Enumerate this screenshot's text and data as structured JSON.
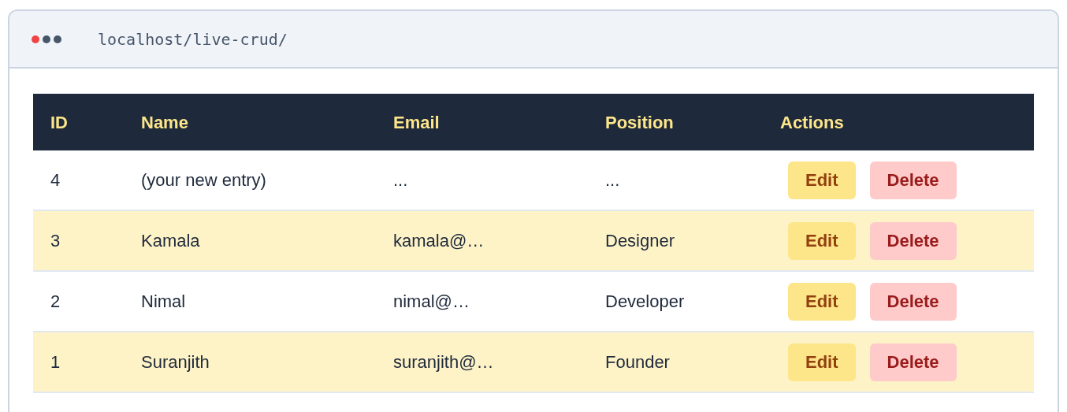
{
  "browser": {
    "url": "localhost/live-crud/"
  },
  "table": {
    "columns": [
      "ID",
      "Name",
      "Email",
      "Position",
      "Actions"
    ],
    "rows": [
      {
        "id": "4",
        "name": "(your new entry)",
        "email": "...",
        "position": "...",
        "highlighted": false,
        "actions": [
          "Edit",
          "Delete"
        ]
      },
      {
        "id": "3",
        "name": "Kamala",
        "email": "kamala@…",
        "position": "Designer",
        "highlighted": true,
        "actions": [
          "Edit",
          "Delete"
        ]
      },
      {
        "id": "2",
        "name": "Nimal",
        "email": "nimal@…",
        "position": "Developer",
        "highlighted": false,
        "actions": [
          "Edit",
          "Delete"
        ]
      },
      {
        "id": "1",
        "name": "Suranjith",
        "email": "suranjith@…",
        "position": "Founder",
        "highlighted": true,
        "actions": [
          "Edit",
          "Delete"
        ]
      }
    ]
  }
}
